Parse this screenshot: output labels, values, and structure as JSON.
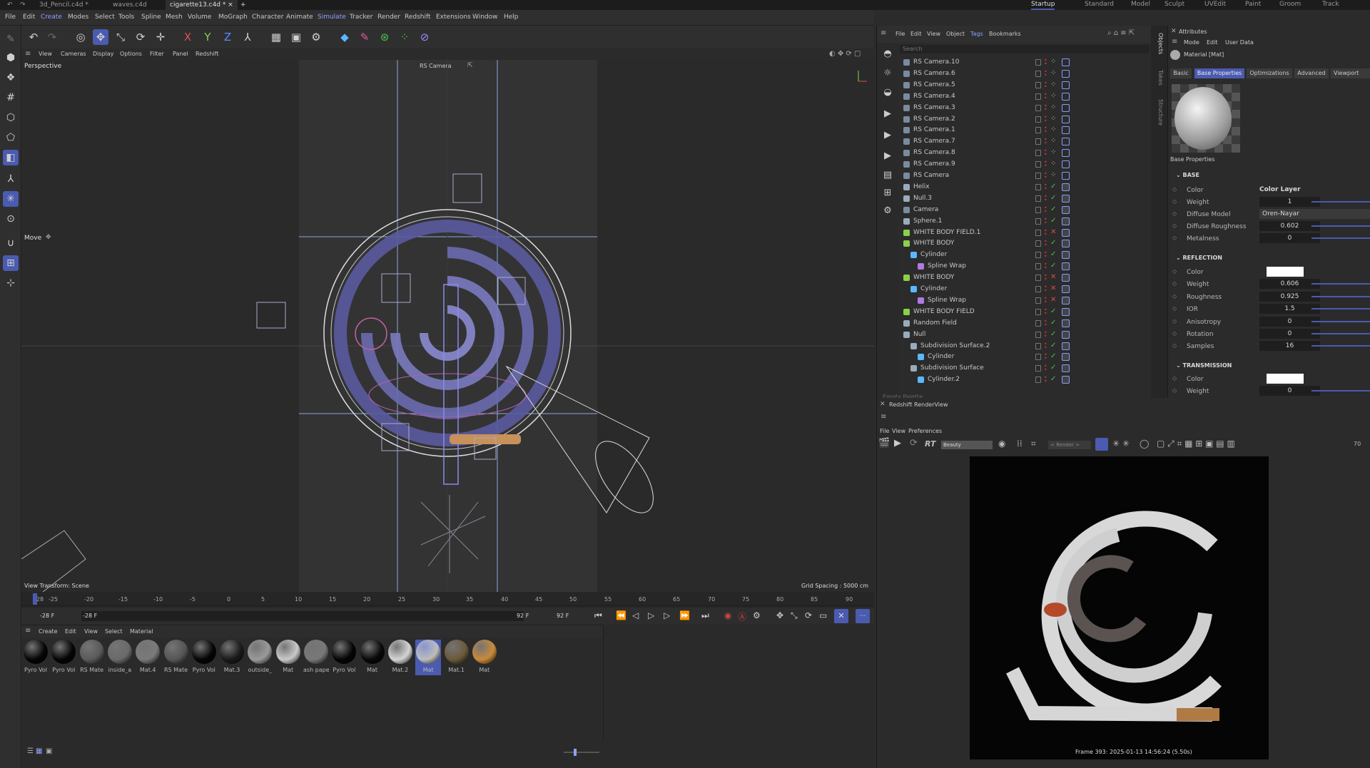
{
  "window_tabs": [
    {
      "label": "3d_Pencil.c4d *"
    },
    {
      "label": "waves.c4d"
    },
    {
      "label": "cigarette13.c4d *"
    }
  ],
  "layout_tabs": [
    "Startup",
    "Standard",
    "Model",
    "Sculpt",
    "UVEdit",
    "Paint",
    "Groom",
    "Track"
  ],
  "menubar": [
    "File",
    "Edit",
    "Create",
    "Modes",
    "Select",
    "Tools",
    "Spline",
    "Mesh",
    "Volume",
    "MoGraph",
    "Character",
    "Animate",
    "Simulate",
    "Tracker",
    "Render",
    "Redshift",
    "Extensions",
    "Window",
    "Help"
  ],
  "toolbar_axes": {
    "x": "X",
    "y": "Y",
    "z": "Z"
  },
  "viewport": {
    "menu": [
      "View",
      "Cameras",
      "Display",
      "Options",
      "Filter",
      "Panel",
      "Redshift"
    ],
    "label": "Perspective",
    "camera": "RS Camera",
    "tool": "Move",
    "view_transform": "View Transform: Scene",
    "grid_spacing": "Grid Spacing : 5000 cm"
  },
  "timeline": {
    "ticks": [
      "-28",
      "-25",
      "-20",
      "-15",
      "-10",
      "-5",
      "0",
      "5",
      "10",
      "15",
      "20",
      "25",
      "30",
      "35",
      "40",
      "45",
      "50",
      "55",
      "60",
      "65",
      "70",
      "75",
      "80",
      "85",
      "90"
    ],
    "start": "-28 F",
    "start2": "-28 F",
    "end": "92 F",
    "end2": "92 F"
  },
  "material_manager": {
    "menu": [
      "Create",
      "Edit",
      "View",
      "Select",
      "Material"
    ],
    "materials": [
      {
        "label": "Pyro Vol",
        "color": "#050505"
      },
      {
        "label": "Pyro Vol",
        "color": "#050505"
      },
      {
        "label": "RS Mate",
        "color": "#5a5a5a"
      },
      {
        "label": "inside_a",
        "color": "#6a6a6a"
      },
      {
        "label": "Mat.4",
        "color": "#7a7a7a"
      },
      {
        "label": "RS Mate",
        "color": "#555555"
      },
      {
        "label": "Pyro Vol",
        "color": "#050505"
      },
      {
        "label": "Mat.3",
        "color": "#1a1a1a"
      },
      {
        "label": "outside_",
        "color": "#9a9a9a"
      },
      {
        "label": "Mat",
        "color": "#c9c9c9"
      },
      {
        "label": "ash pape",
        "color": "#787878"
      },
      {
        "label": "Pyro Vol",
        "color": "#050505"
      },
      {
        "label": "Mat",
        "color": "#080808"
      },
      {
        "label": "Mat.2",
        "color": "#d4d4d4"
      },
      {
        "label": "Mat",
        "color": "#bdbdbd"
      },
      {
        "label": "Mat.1",
        "color": "#6b5a3a"
      },
      {
        "label": "Mat",
        "color": "#c88a3a"
      }
    ]
  },
  "objects": {
    "menu": [
      "File",
      "Edit",
      "View",
      "Object",
      "Tags",
      "Bookmarks"
    ],
    "search_placeholder": "Search",
    "items": [
      {
        "name": "RS Camera.10",
        "indent": 0
      },
      {
        "name": "RS Camera.6",
        "indent": 0
      },
      {
        "name": "RS Camera.5",
        "indent": 0
      },
      {
        "name": "RS Camera.4",
        "indent": 0
      },
      {
        "name": "RS Camera.3",
        "indent": 0
      },
      {
        "name": "RS Camera.2",
        "indent": 0
      },
      {
        "name": "RS Camera.1",
        "indent": 0
      },
      {
        "name": "RS Camera.7",
        "indent": 0
      },
      {
        "name": "RS Camera.8",
        "indent": 0
      },
      {
        "name": "RS Camera.9",
        "indent": 0
      },
      {
        "name": "RS Camera",
        "indent": 0
      },
      {
        "name": "Helix",
        "indent": 0
      },
      {
        "name": "Null.3",
        "indent": 0
      },
      {
        "name": "Camera",
        "indent": 0
      },
      {
        "name": "Sphere.1",
        "indent": 0
      },
      {
        "name": "WHITE BODY FIELD.1",
        "indent": 0
      },
      {
        "name": "WHITE BODY",
        "indent": 0
      },
      {
        "name": "Cylinder",
        "indent": 1
      },
      {
        "name": "Spline Wrap",
        "indent": 2
      },
      {
        "name": "WHITE BODY",
        "indent": 0
      },
      {
        "name": "Cylinder",
        "indent": 1
      },
      {
        "name": "Spline Wrap",
        "indent": 2
      },
      {
        "name": "WHITE BODY FIELD",
        "indent": 0
      },
      {
        "name": "Random Field",
        "indent": 0
      },
      {
        "name": "Null",
        "indent": 0
      },
      {
        "name": "Subdivision Surface.2",
        "indent": 1
      },
      {
        "name": "Cylinder",
        "indent": 2
      },
      {
        "name": "Subdivision Surface",
        "indent": 1
      },
      {
        "name": "Cylinder.2",
        "indent": 2
      }
    ],
    "empty_palette": "Empty Palette"
  },
  "side_tabs": [
    "Objects",
    "Takes",
    "Structure"
  ],
  "attributes": {
    "title": "Attributes",
    "menu": [
      "Mode",
      "Edit",
      "User Data"
    ],
    "object_name": "Material [Mat]",
    "tabs": [
      "Basic",
      "Base Properties",
      "Optimizations",
      "Advanced",
      "Viewport"
    ],
    "preview_caption": "Base Properties",
    "sections": {
      "base": "BASE",
      "reflection": "REFLECTION",
      "transmission": "TRANSMISSION"
    },
    "base_rows": [
      {
        "label": "Color",
        "value": "Color Layer"
      },
      {
        "label": "Weight",
        "value": "1"
      },
      {
        "label": "Diffuse Model",
        "value": "Oren-Nayar"
      },
      {
        "label": "Diffuse Roughness",
        "value": "0.602"
      },
      {
        "label": "Metalness",
        "value": "0"
      }
    ],
    "reflection_rows": [
      {
        "label": "Color",
        "value": ""
      },
      {
        "label": "Weight",
        "value": "0.606"
      },
      {
        "label": "Roughness",
        "value": "0.925"
      },
      {
        "label": "IOR",
        "value": "1.5"
      },
      {
        "label": "Anisotropy",
        "value": "0"
      },
      {
        "label": "Rotation",
        "value": "0"
      },
      {
        "label": "Samples",
        "value": "16"
      }
    ],
    "transmission_rows": [
      {
        "label": "Color",
        "value": ""
      },
      {
        "label": "Weight",
        "value": "0"
      }
    ]
  },
  "renderview": {
    "title": "Redshift RenderView",
    "menu": [
      "File",
      "View",
      "Preferences"
    ],
    "rt": "RT",
    "aov": "Beauty",
    "render_select": "< Render >",
    "zoom": "70",
    "frame_info": "Frame  393:  2025-01-13  14:56:24  (5.50s)"
  }
}
